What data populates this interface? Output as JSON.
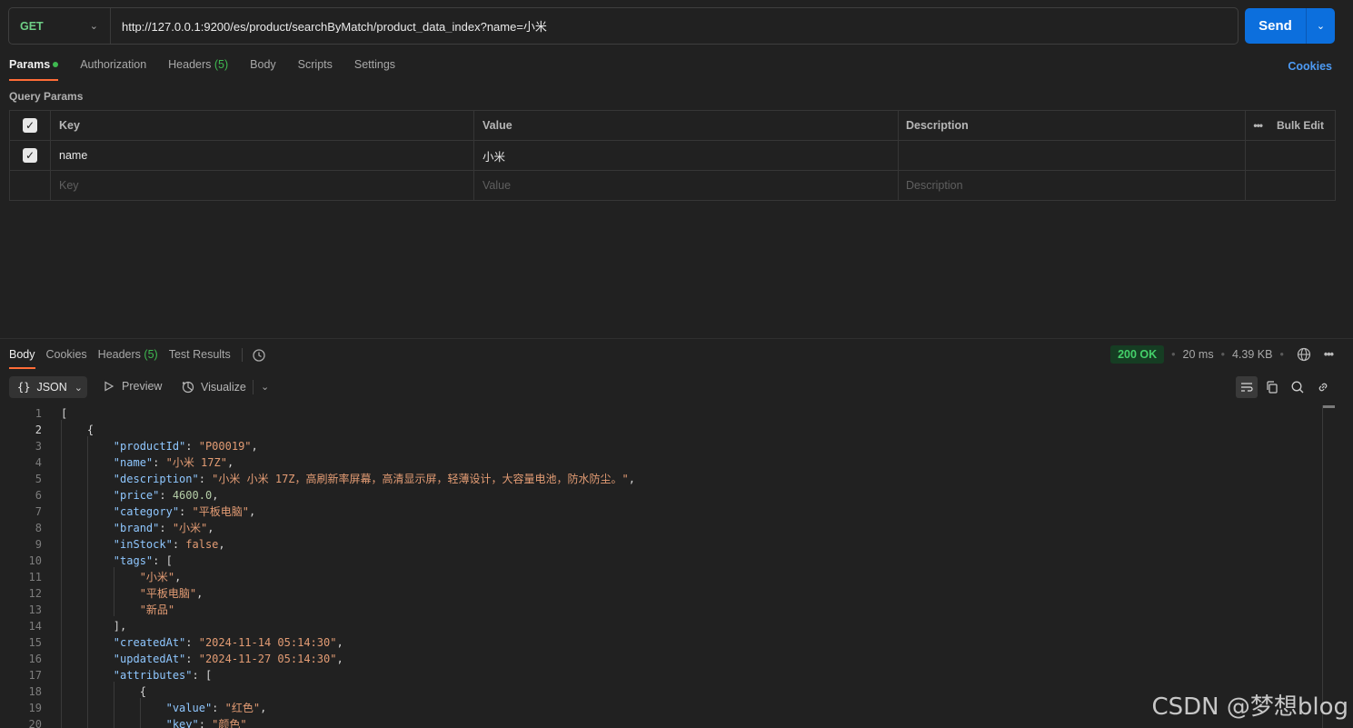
{
  "request": {
    "method": "GET",
    "url": "http://127.0.0.1:9200/es/product/searchByMatch/product_data_index?name=小米",
    "send_label": "Send"
  },
  "request_tabs": {
    "params": "Params",
    "authorization": "Authorization",
    "headers": "Headers",
    "headers_count": "(5)",
    "body": "Body",
    "scripts": "Scripts",
    "settings": "Settings",
    "cookies": "Cookies"
  },
  "query_params": {
    "title": "Query Params",
    "headers": {
      "key": "Key",
      "value": "Value",
      "description": "Description",
      "bulk_edit": "Bulk Edit"
    },
    "rows": [
      {
        "key": "name",
        "value": "小米",
        "description": ""
      }
    ],
    "placeholder": {
      "key": "Key",
      "value": "Value",
      "description": "Description"
    }
  },
  "response_tabs": {
    "body": "Body",
    "cookies": "Cookies",
    "headers": "Headers",
    "headers_count": "(5)",
    "test_results": "Test Results"
  },
  "response_status": {
    "status": "200 OK",
    "time": "20 ms",
    "size": "4.39 KB"
  },
  "response_toolbar": {
    "format": "JSON",
    "preview": "Preview",
    "visualize": "Visualize"
  },
  "code_lines": {
    "l1": "[",
    "l2": "{",
    "l3": {
      "key": "\"productId\"",
      "value": "\"P00019\""
    },
    "l4": {
      "key": "\"name\"",
      "value": "\"小米 17Z\""
    },
    "l5": {
      "key": "\"description\"",
      "value": "\"小米 小米 17Z，高刷新率屏幕，高清显示屏，轻薄设计，大容量电池，防水防尘。\""
    },
    "l6": {
      "key": "\"price\"",
      "value": "4600.0"
    },
    "l7": {
      "key": "\"category\"",
      "value": "\"平板电脑\""
    },
    "l8": {
      "key": "\"brand\"",
      "value": "\"小米\""
    },
    "l9": {
      "key": "\"inStock\"",
      "value": "false"
    },
    "l10": {
      "key": "\"tags\"",
      "value": "["
    },
    "l11": "\"小米\"",
    "l12": "\"平板电脑\"",
    "l13": "\"新品\"",
    "l14": "],",
    "l15": {
      "key": "\"createdAt\"",
      "value": "\"2024-11-14 05:14:30\""
    },
    "l16": {
      "key": "\"updatedAt\"",
      "value": "\"2024-11-27 05:14:30\""
    },
    "l17": {
      "key": "\"attributes\"",
      "value": "["
    },
    "l18": "{",
    "l19": {
      "key": "\"value\"",
      "value": "\"红色\""
    },
    "l20": {
      "key": "\"key\"",
      "value": "\"颜色\""
    }
  },
  "watermark": "CSDN @梦想blog"
}
